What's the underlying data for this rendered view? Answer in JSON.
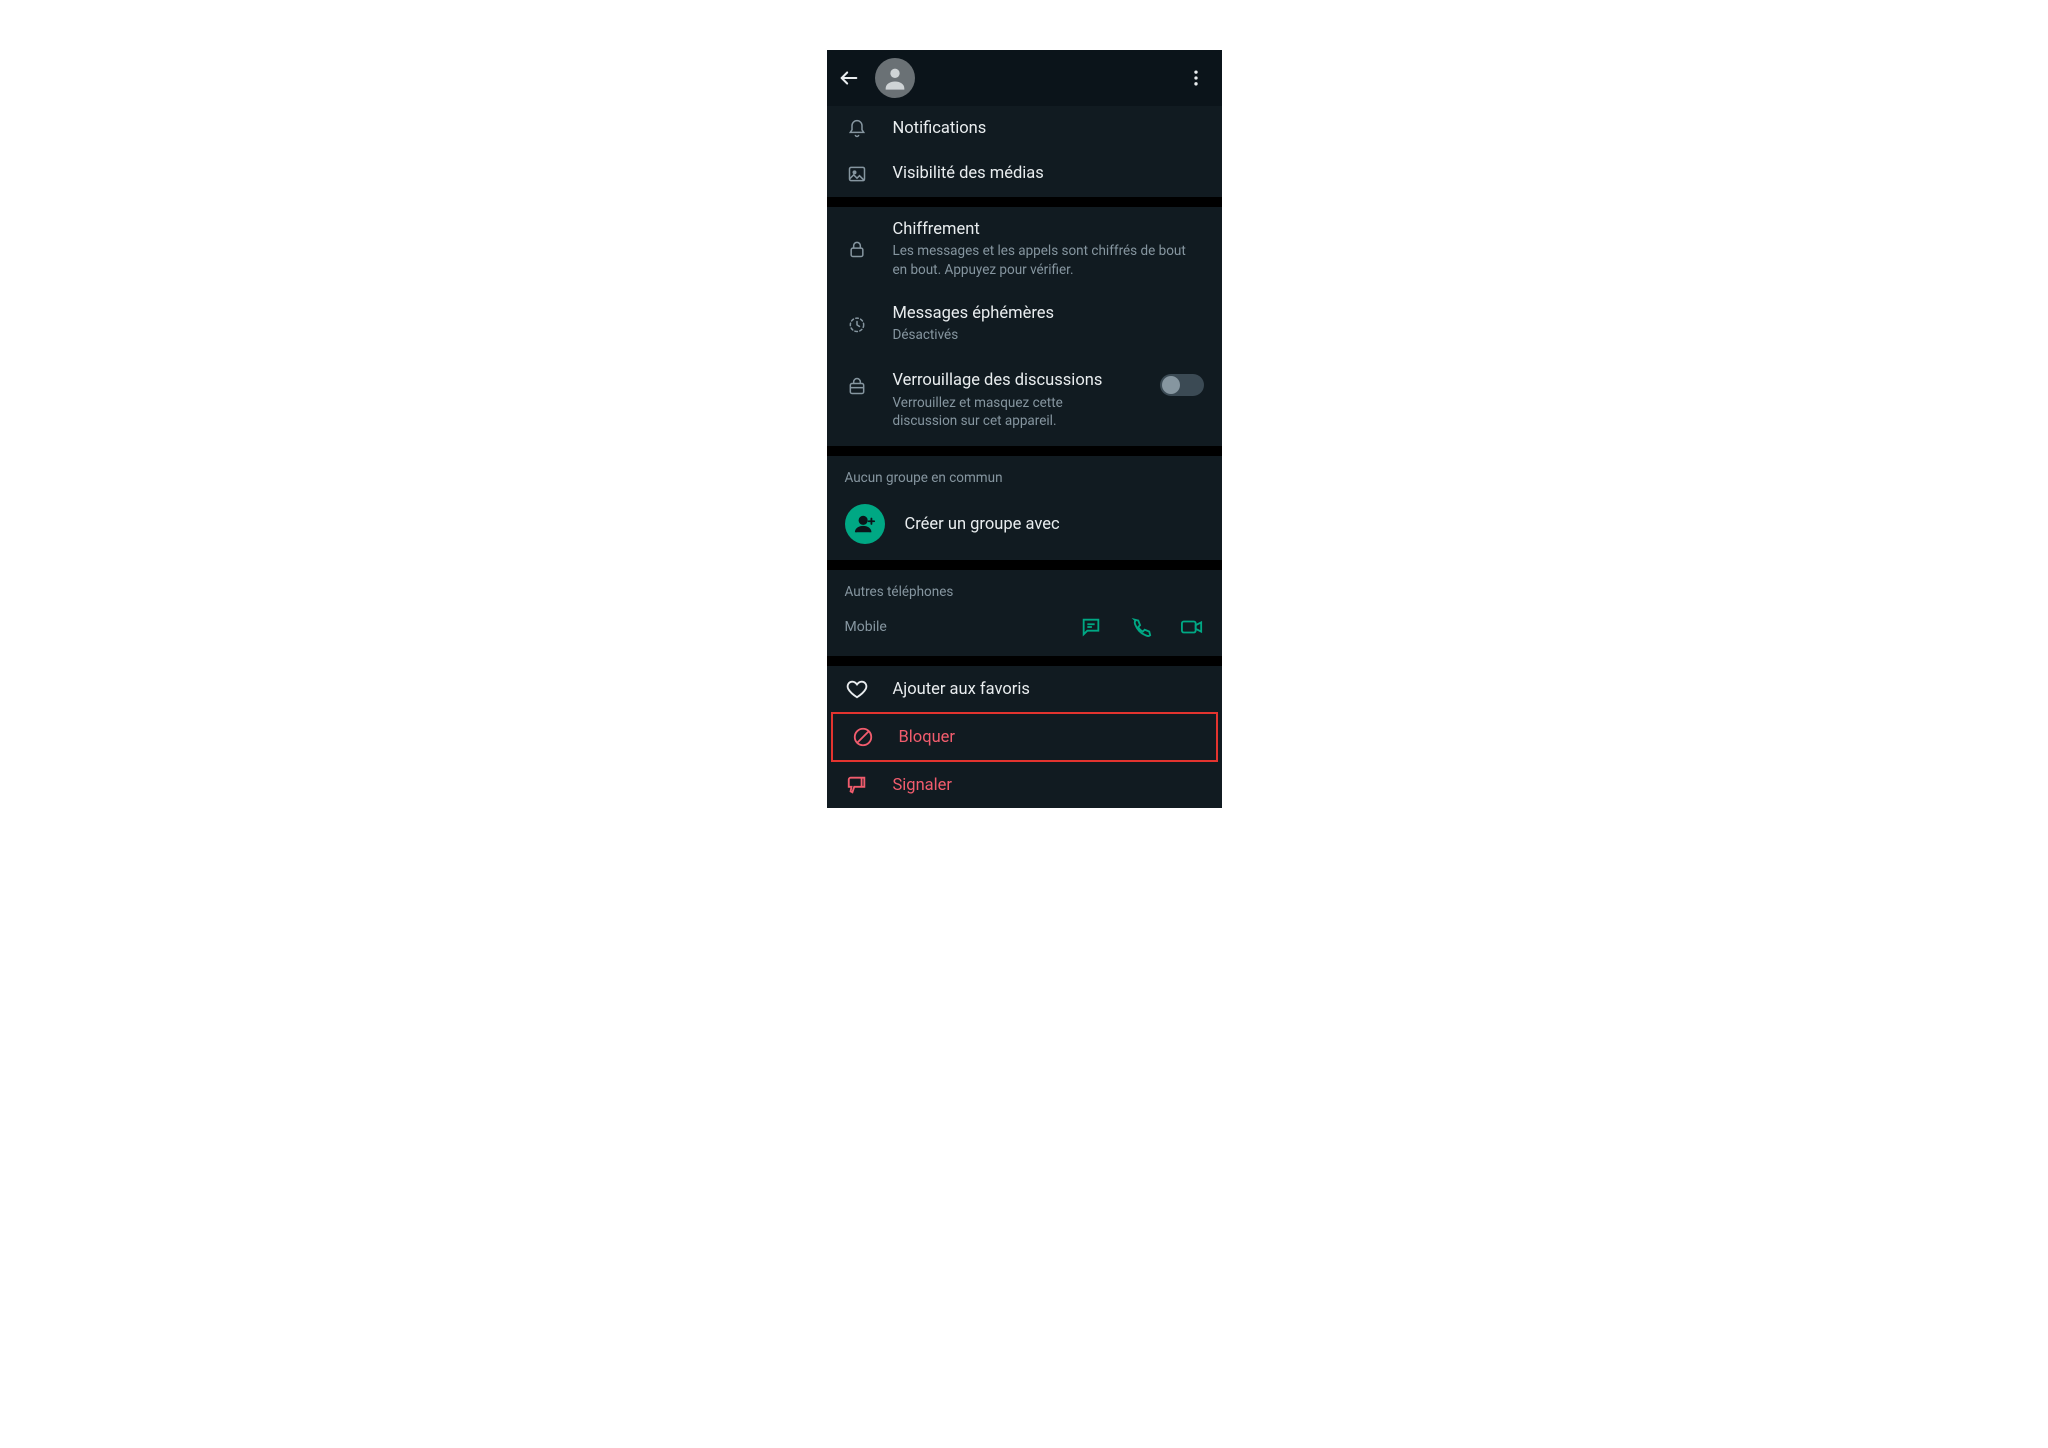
{
  "header": {},
  "settings": {
    "notifications": "Notifications",
    "media_visibility": "Visibilité des médias"
  },
  "security": {
    "encryption_title": "Chiffrement",
    "encryption_sub": "Les messages et les appels sont chiffrés de bout en bout. Appuyez pour vérifier.",
    "ephemeral_title": "Messages éphémères",
    "ephemeral_sub": "Désactivés",
    "chatlock_title": "Verrouillage des discussions",
    "chatlock_sub": "Verrouillez et masquez cette discussion sur cet appareil."
  },
  "groups": {
    "header": "Aucun groupe en commun",
    "create_label": "Créer un groupe avec"
  },
  "phones": {
    "header": "Autres téléphones",
    "mobile_label": "Mobile"
  },
  "actions": {
    "favorite": "Ajouter aux favoris",
    "block": "Bloquer",
    "report": "Signaler"
  }
}
